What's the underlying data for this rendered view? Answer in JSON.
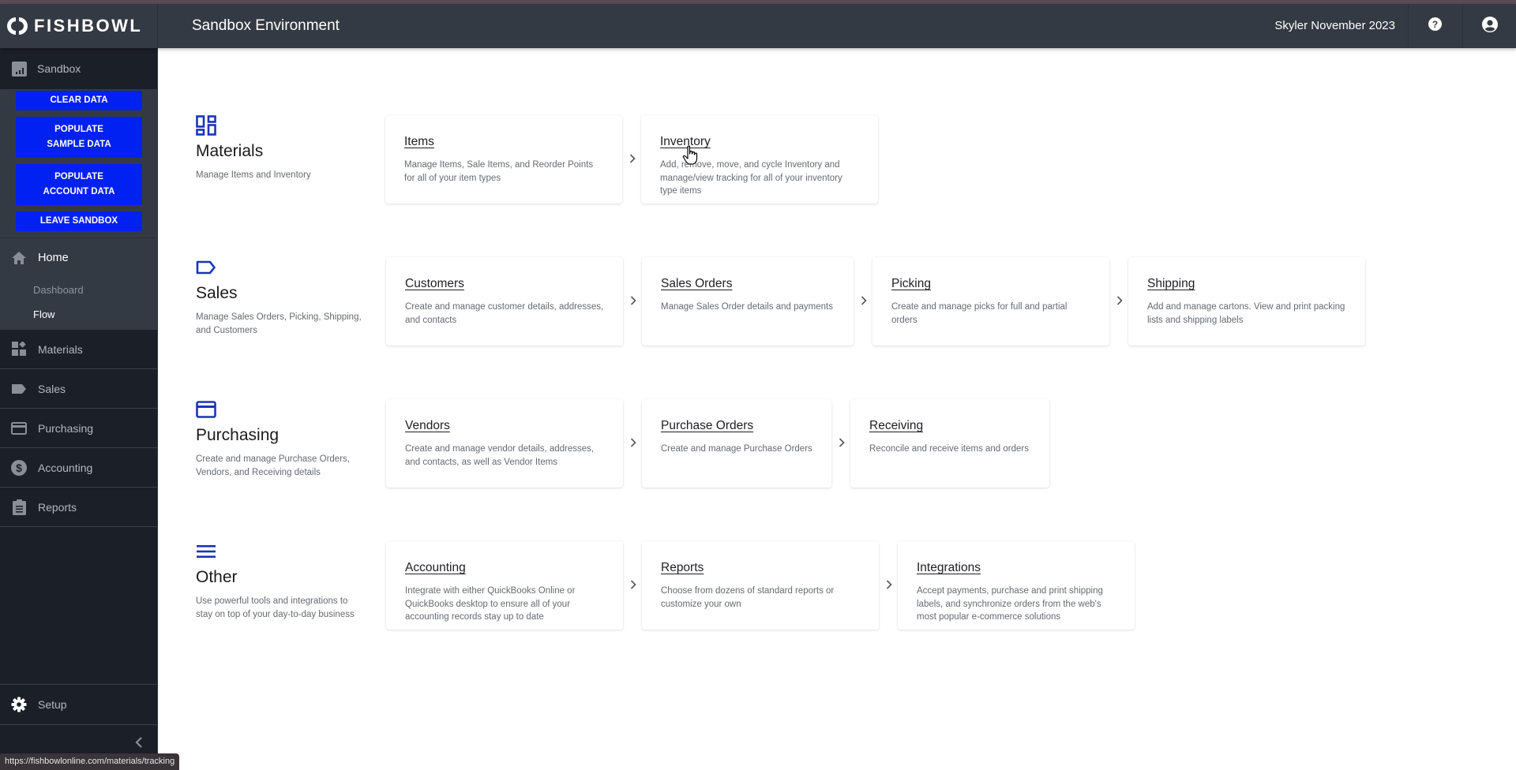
{
  "header": {
    "brand": "FISHBOWL",
    "environment_title": "Sandbox Environment",
    "user_name": "Skyler November 2023",
    "icons": {
      "help": "help-circle-icon",
      "user": "user-account-icon",
      "logo": "fishbowl-logo-icon"
    }
  },
  "sidebar": {
    "sandbox_label": "Sandbox",
    "sandbox_buttons": [
      {
        "label": "CLEAR DATA"
      },
      {
        "label_line1": "POPULATE",
        "label_line2": "SAMPLE DATA"
      },
      {
        "label_line1": "POPULATE",
        "label_line2": "ACCOUNT DATA"
      },
      {
        "label": "LEAVE SANDBOX"
      }
    ],
    "home": {
      "label": "Home",
      "subitems": [
        {
          "label": "Dashboard",
          "active": false
        },
        {
          "label": "Flow",
          "active": true
        }
      ]
    },
    "items": [
      {
        "label": "Materials",
        "icon": "materials-icon"
      },
      {
        "label": "Sales",
        "icon": "tag-icon"
      },
      {
        "label": "Purchasing",
        "icon": "credit-card-icon"
      },
      {
        "label": "Accounting",
        "icon": "dollar-circle-icon"
      },
      {
        "label": "Reports",
        "icon": "clipboard-icon"
      }
    ],
    "setup_label": "Setup"
  },
  "status_bar": {
    "url": "https://fishbowlonline.com/materials/tracking"
  },
  "sections": [
    {
      "title": "Materials",
      "description": "Manage Items and Inventory",
      "icon": "dashboard-grid-icon",
      "cards": [
        {
          "title": "Items",
          "description": "Manage Items, Sale Items, and Reorder Points for all of your item types"
        },
        {
          "title": "Inventory",
          "description": "Add, remove, move, and cycle Inventory and manage/view tracking for all of your inventory type items"
        }
      ]
    },
    {
      "title": "Sales",
      "description": "Manage Sales Orders, Picking, Shipping, and Customers",
      "icon": "tag-outline-icon",
      "cards": [
        {
          "title": "Customers",
          "description": "Create and manage customer details, addresses, and contacts"
        },
        {
          "title": "Sales Orders",
          "description": "Manage Sales Order details and payments"
        },
        {
          "title": "Picking",
          "description": "Create and manage picks for full and partial orders"
        },
        {
          "title": "Shipping",
          "description": "Add and manage cartons. View and print packing lists and shipping labels"
        }
      ]
    },
    {
      "title": "Purchasing",
      "description": "Create and manage Purchase Orders, Vendors, and Receiving details",
      "icon": "credit-card-outline-icon",
      "cards": [
        {
          "title": "Vendors",
          "description": "Create and manage vendor details, addresses, and contacts, as well as Vendor Items"
        },
        {
          "title": "Purchase Orders",
          "description": "Create and manage Purchase Orders"
        },
        {
          "title": "Receiving",
          "description": "Reconcile and receive items and orders"
        }
      ]
    },
    {
      "title": "Other",
      "description": "Use powerful tools and integrations to stay on top of your day-to-day business",
      "icon": "menu-lines-icon",
      "cards": [
        {
          "title": "Accounting",
          "description": "Integrate with either QuickBooks Online or QuickBooks desktop to ensure all of your accounting records stay up to date"
        },
        {
          "title": "Reports",
          "description": "Choose from dozens of standard reports or customize your own"
        },
        {
          "title": "Integrations",
          "description": "Accept payments, purchase and print shipping labels, and synchronize orders from the web's most popular e-commerce solutions"
        }
      ]
    }
  ],
  "colors": {
    "accent_blue": "#0021f2",
    "section_icon_blue": "#1a34b8",
    "topbar": "#343a44",
    "sidebar": "#1b1f27"
  }
}
